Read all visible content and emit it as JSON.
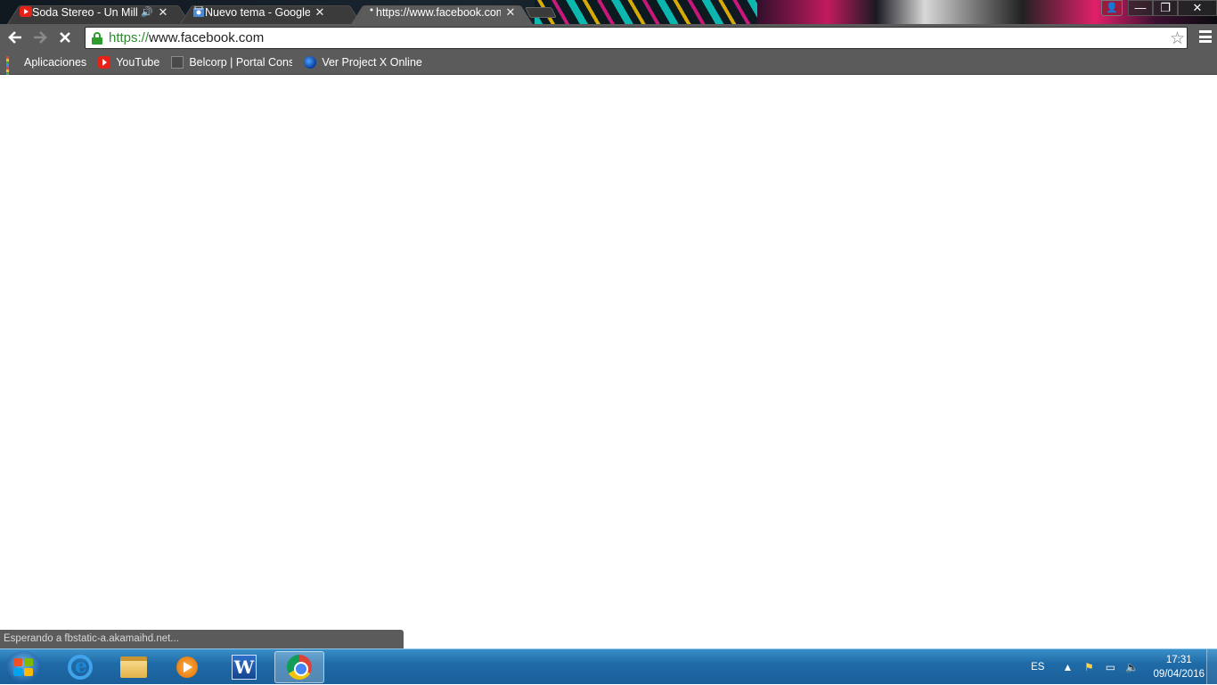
{
  "browser": {
    "tabs": [
      {
        "title": "Soda Stereo - Un Millón de Años Luz",
        "audio": "🔊",
        "close": "✕",
        "favicon": "youtube-icon"
      },
      {
        "title": "Nuevo tema - Google Chrome",
        "close": "✕",
        "favicon": "chrome-store-icon"
      },
      {
        "title": "https://www.facebook.com",
        "close": "✕",
        "favicon": "loading-dot-icon"
      }
    ],
    "window_controls": {
      "profile": "👤",
      "minimize": "—",
      "maximize": "❐",
      "close": "✕"
    },
    "toolbar": {
      "back": "🡐",
      "forward": "🡒",
      "stop": "✕",
      "url_scheme": "https://",
      "url_rest": "www.facebook.com",
      "star": "☆"
    },
    "bookmarks": [
      {
        "label": "Aplicaciones",
        "icon": "apps-grid-icon"
      },
      {
        "label": "YouTube",
        "icon": "youtube-icon"
      },
      {
        "label": "Belcorp | Portal Consu",
        "icon": "page-icon"
      },
      {
        "label": "Ver Project X Online G",
        "icon": "globe-icon"
      }
    ],
    "status_text": "Esperando a fbstatic-a.akamaihd.net..."
  },
  "taskbar": {
    "items": [
      {
        "name": "internet-explorer"
      },
      {
        "name": "file-explorer"
      },
      {
        "name": "media-player"
      },
      {
        "name": "microsoft-word",
        "glyph": "W"
      },
      {
        "name": "google-chrome",
        "active": true
      }
    ],
    "tray": {
      "language": "ES",
      "show_hidden": "▲",
      "flag": "⚑",
      "network": "▭",
      "volume": "🔈"
    },
    "clock": {
      "time": "17:31",
      "date": "09/04/2016"
    }
  },
  "colors": {
    "chrome_frame": "#5b5b5b",
    "url_secure_green": "#2e8b2e",
    "taskbar_blue": "#1f6ba8"
  }
}
